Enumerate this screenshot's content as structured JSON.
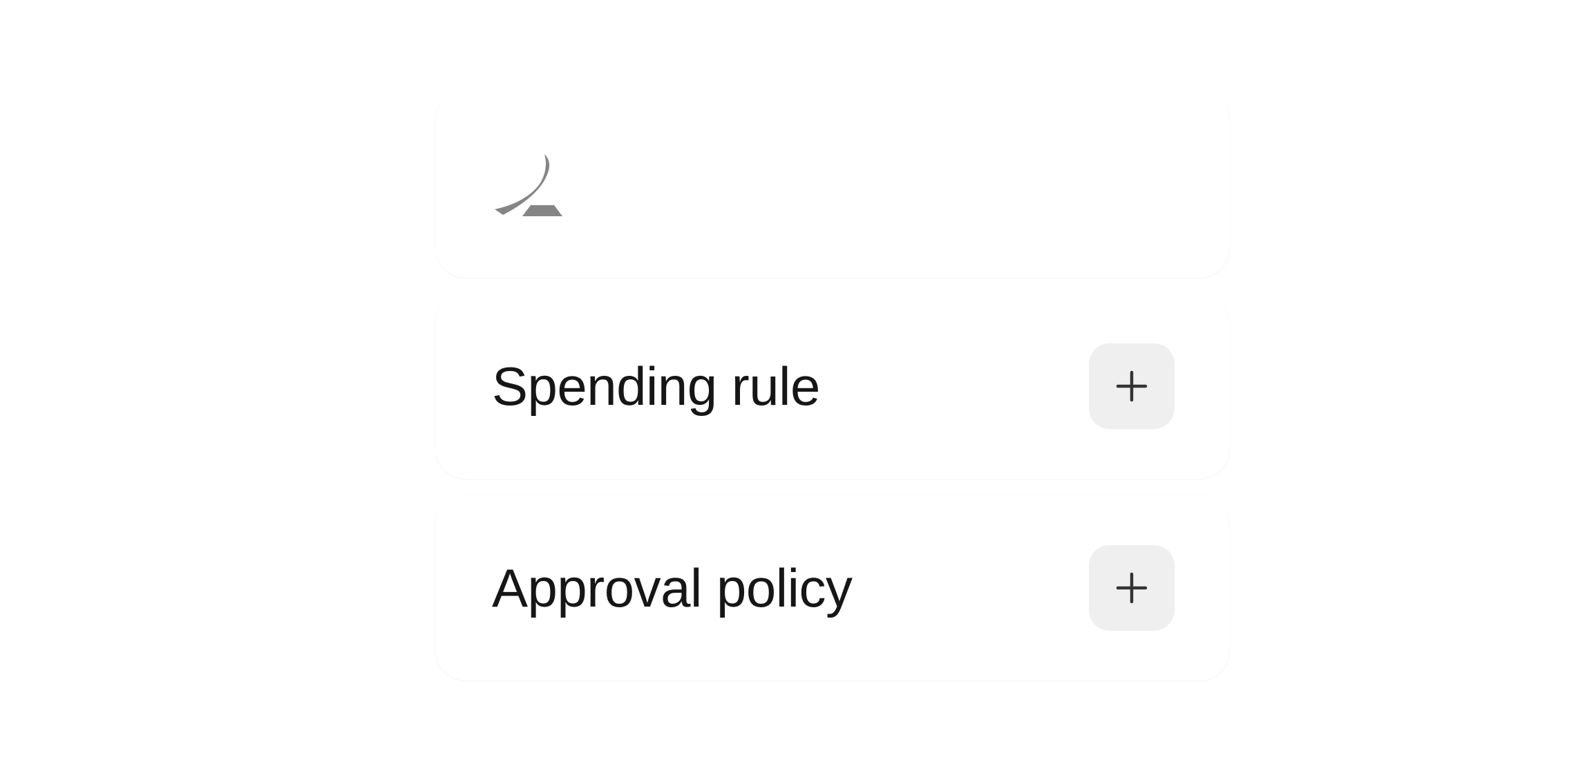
{
  "logo": {
    "icon": "brand-logo-icon"
  },
  "rows": [
    {
      "label": "Spending rule",
      "action_icon": "plus-icon"
    },
    {
      "label": "Approval policy",
      "action_icon": "plus-icon"
    }
  ],
  "colors": {
    "card_background": "#ffffff",
    "button_background": "#efefef",
    "text": "#161616",
    "icon": "#333333",
    "logo": "#858585"
  }
}
